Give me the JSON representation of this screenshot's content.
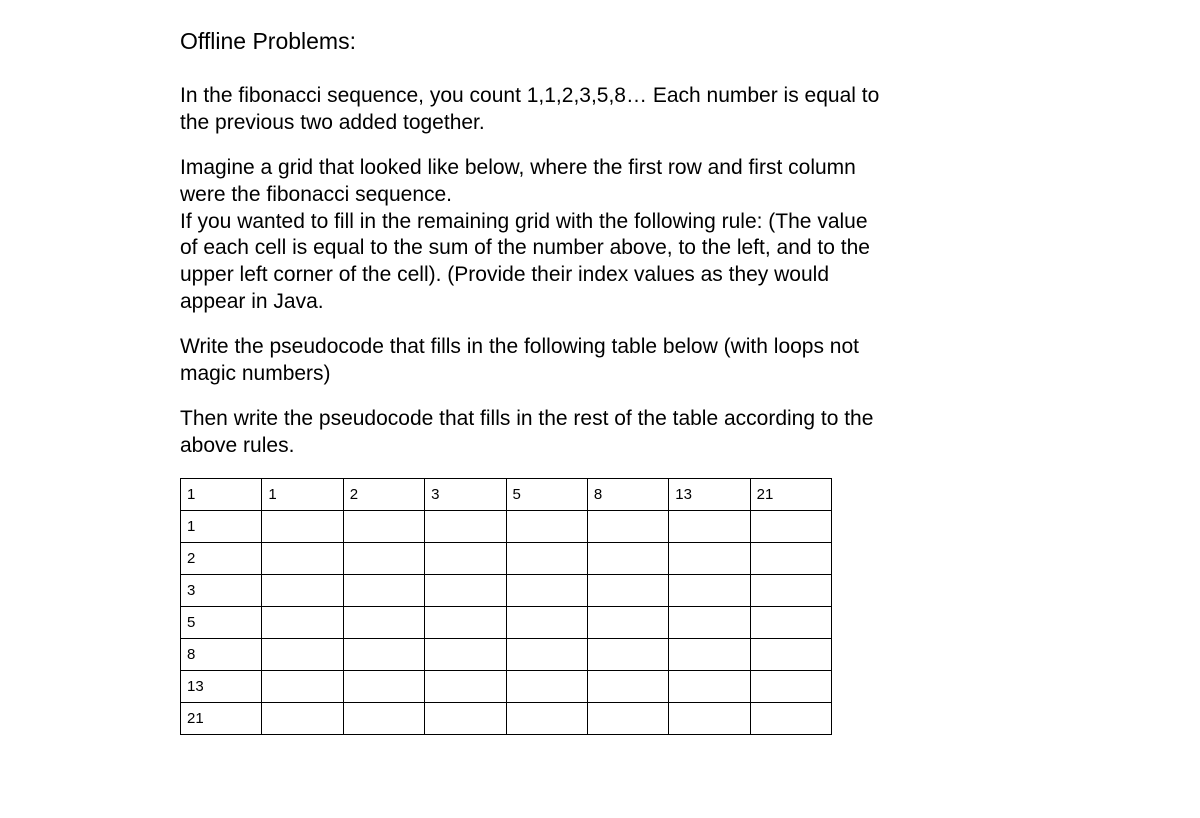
{
  "heading": "Offline Problems:",
  "paragraphs": [
    "In the fibonacci sequence, you count 1,1,2,3,5,8… Each number is equal to the previous two added together.",
    "Imagine a grid that looked like below, where the first row and first column were the fibonacci sequence.\nIf you wanted to fill in the remaining grid with the following rule: (The value of each cell is equal to the sum of the number above, to the left, and to the upper left corner of the cell). (Provide their index values as they would appear in Java.",
    "Write the pseudocode that fills in the following table below (with loops not magic numbers)",
    "Then write the pseudocode that fills in the rest of the table according to the above rules."
  ],
  "grid": [
    [
      "1",
      "1",
      "2",
      "3",
      "5",
      "8",
      "13",
      "21"
    ],
    [
      "1",
      "",
      "",
      "",
      "",
      "",
      "",
      ""
    ],
    [
      "2",
      "",
      "",
      "",
      "",
      "",
      "",
      ""
    ],
    [
      "3",
      "",
      "",
      "",
      "",
      "",
      "",
      ""
    ],
    [
      "5",
      "",
      "",
      "",
      "",
      "",
      "",
      ""
    ],
    [
      "8",
      "",
      "",
      "",
      "",
      "",
      "",
      ""
    ],
    [
      "13",
      "",
      "",
      "",
      "",
      "",
      "",
      ""
    ],
    [
      "21",
      "",
      "",
      "",
      "",
      "",
      "",
      ""
    ]
  ]
}
